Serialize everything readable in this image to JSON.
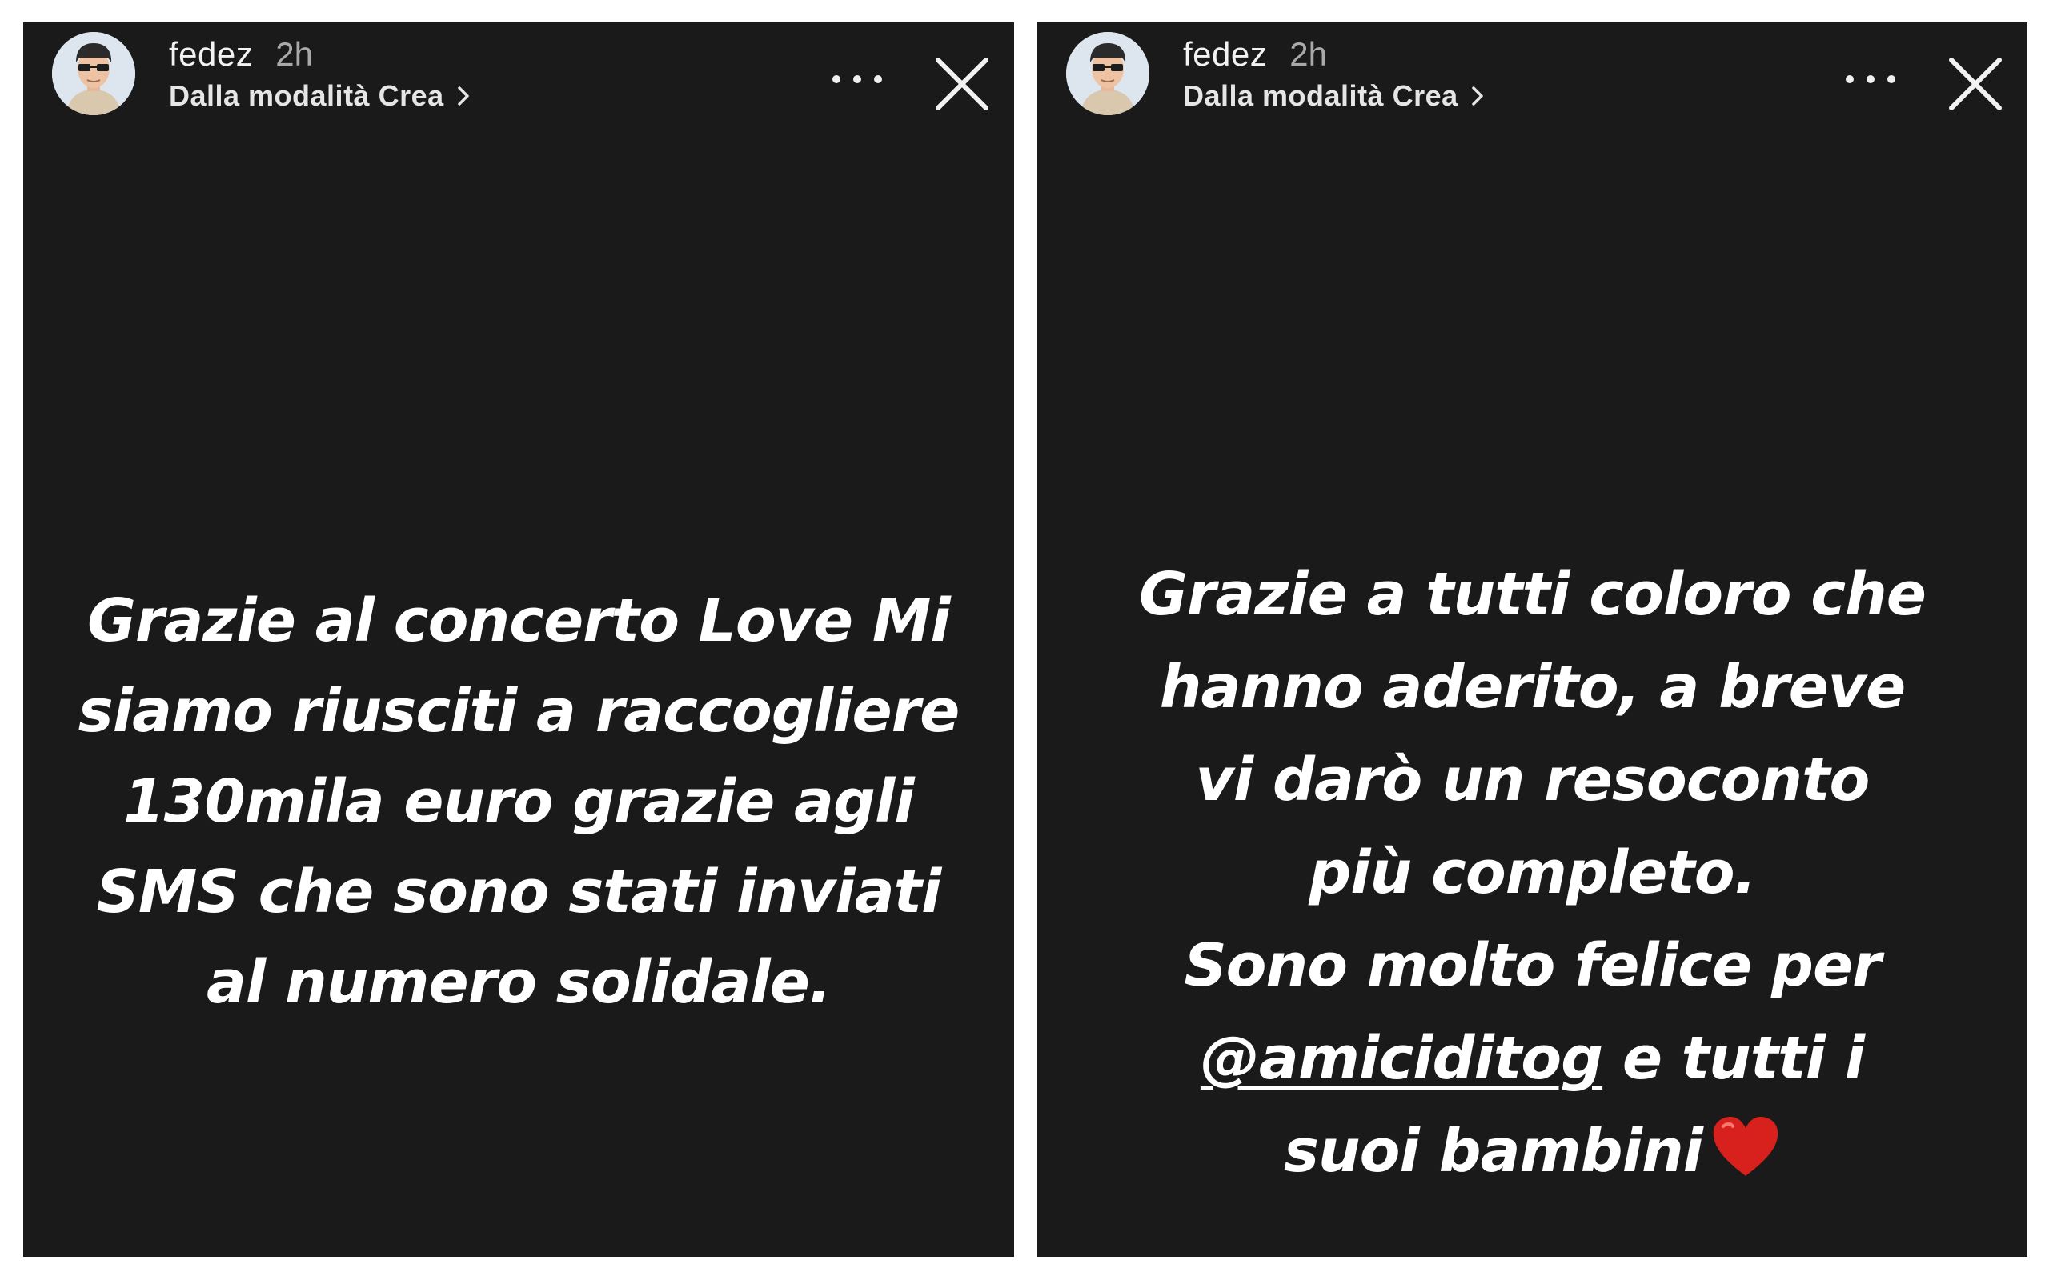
{
  "stories": [
    {
      "username": "fedez",
      "time": "2h",
      "subtitle": "Dalla modalità Crea",
      "text_lines": [
        "Grazie al concerto Love Mi",
        "siamo riusciti a raccogliere",
        "130mila euro grazie agli",
        "SMS che sono stati inviati",
        "al numero solidale."
      ]
    },
    {
      "username": "fedez",
      "time": "2h",
      "subtitle": "Dalla modalità Crea",
      "text_lines": [
        "Grazie a tutti coloro che",
        "hanno aderito, a breve",
        "vi darò un resoconto",
        "più completo.",
        "Sono molto felice per"
      ],
      "mention": "@amiciditog",
      "mention_rest": " e tutti i",
      "last_line": "suoi bambini",
      "emoji": "heart-emoji"
    }
  ],
  "icons": {
    "more": "more-horizontal-icon",
    "close": "close-icon",
    "chevron": "chevron-right-icon"
  },
  "colors": {
    "story_background": "#1a1a1a",
    "text": "#ffffff",
    "heart": "#d8211d"
  }
}
